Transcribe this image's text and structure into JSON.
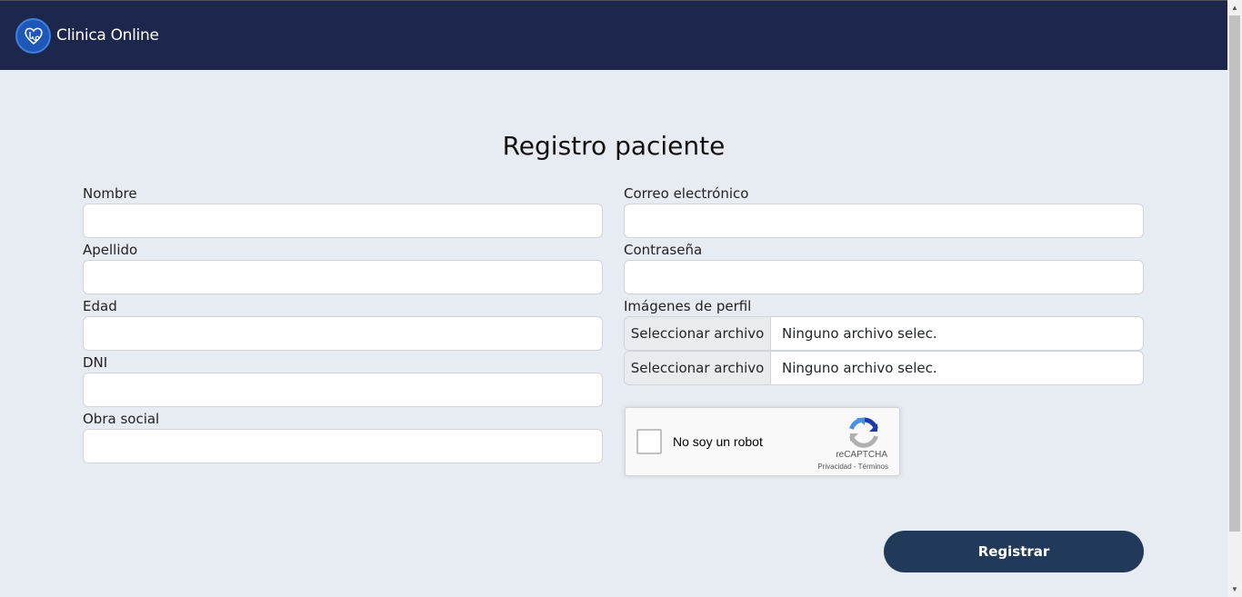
{
  "header": {
    "brand": "Clinica Online",
    "logo_icon": "heart-stethoscope-icon",
    "background": "#1d264b"
  },
  "page": {
    "title": "Registro paciente"
  },
  "form": {
    "left_fields": [
      {
        "label": "Nombre",
        "value": ""
      },
      {
        "label": "Apellido",
        "value": ""
      },
      {
        "label": "Edad",
        "value": ""
      },
      {
        "label": "DNI",
        "value": ""
      },
      {
        "label": "Obra social",
        "value": ""
      }
    ],
    "right_fields": [
      {
        "label": "Correo electrónico",
        "value": ""
      },
      {
        "label": "Contraseña",
        "value": ""
      }
    ],
    "images": {
      "label": "Imágenes de perfil",
      "files": [
        {
          "button": "Seleccionar archivo",
          "status": "Ninguno archivo selec."
        },
        {
          "button": "Seleccionar archivo",
          "status": "Ninguno archivo selec."
        }
      ]
    },
    "recaptcha": {
      "label": "No soy un robot",
      "brand": "reCAPTCHA",
      "links": "Privacidad - Términos",
      "checked": false
    },
    "submit_label": "Registrar",
    "submit_color": "#223a5a"
  }
}
